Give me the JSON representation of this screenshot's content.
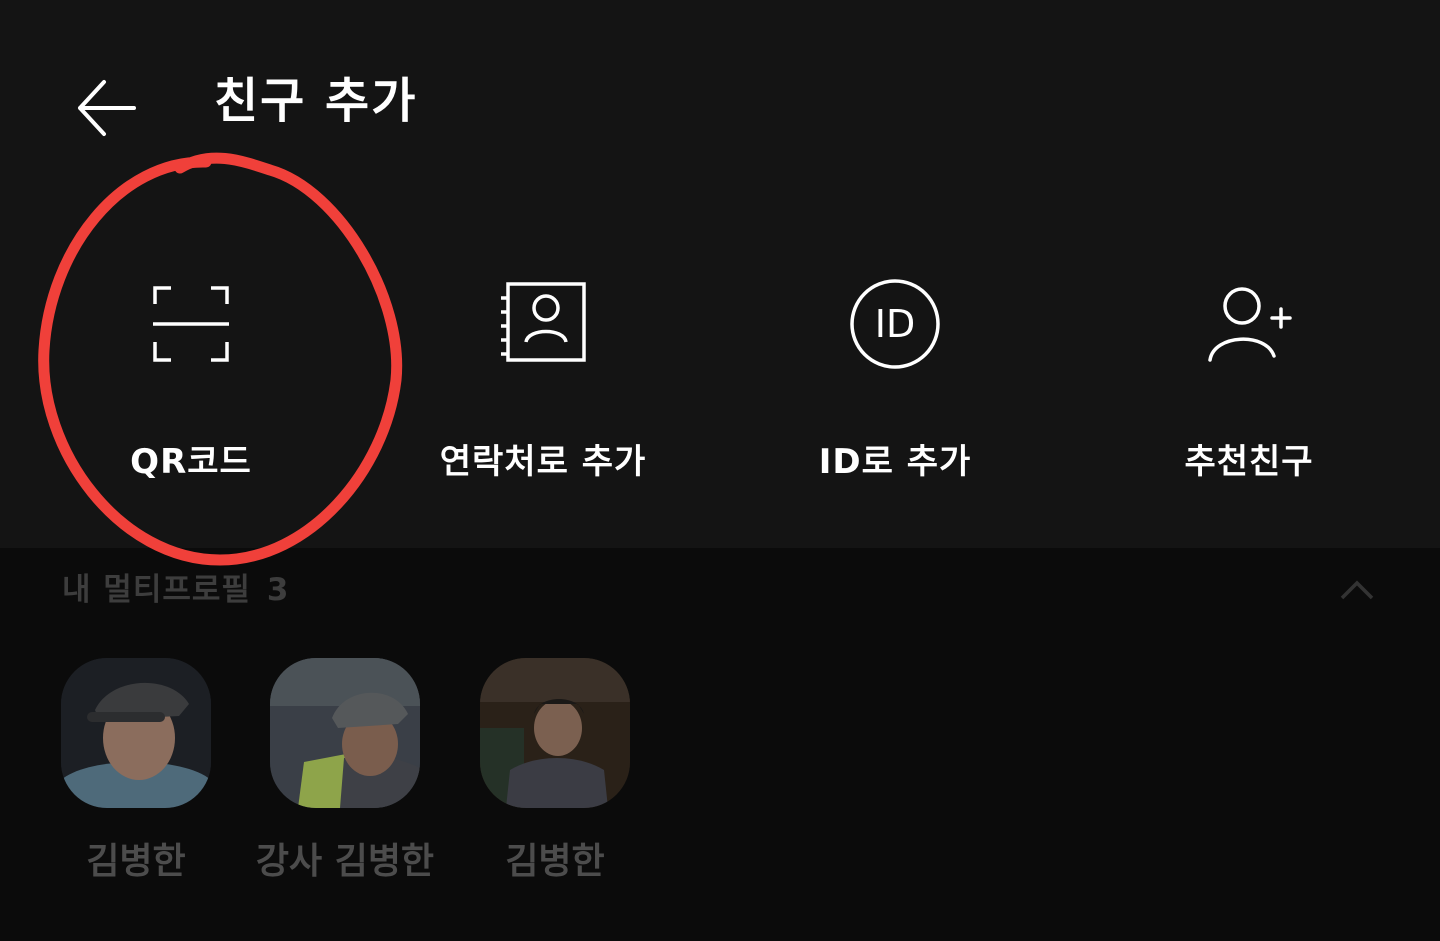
{
  "header": {
    "back_icon": "arrow-left-icon",
    "title": "친구 추가"
  },
  "actions": [
    {
      "label": "QR코드",
      "icon": "qr-scan-icon"
    },
    {
      "label": "연락처로 추가",
      "icon": "contact-book-icon"
    },
    {
      "label": "ID로 추가",
      "icon": "id-circle-icon"
    },
    {
      "label": "추천친구",
      "icon": "person-add-icon"
    }
  ],
  "multi_profile": {
    "title": "내 멀티프로필",
    "count": "3",
    "collapse_icon": "chevron-up-icon",
    "profiles": [
      {
        "name": "김병한"
      },
      {
        "name": "강사 김병한"
      },
      {
        "name": "김병한"
      }
    ]
  },
  "annotation": {
    "color": "#f0403a"
  },
  "colors": {
    "background": "#141414",
    "lower_background": "#0b0b0b",
    "text": "#ffffff",
    "dim_text": "#4c4c4c"
  }
}
